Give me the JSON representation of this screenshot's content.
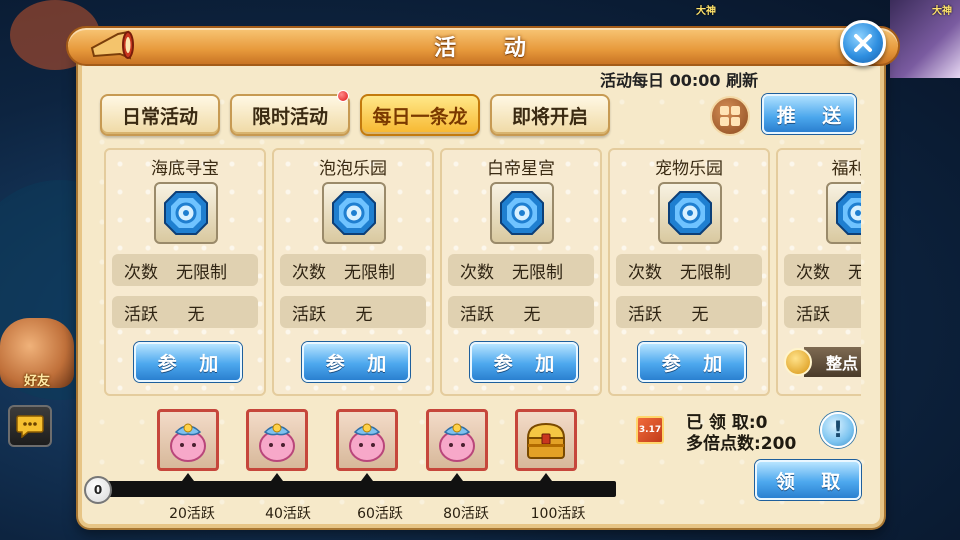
{
  "title": "活 动",
  "refresh_text": "活动每日 00:00 刷新",
  "tabs": [
    {
      "label": "日常活动",
      "active": false
    },
    {
      "label": "限时活动",
      "active": false,
      "has_notification": true
    },
    {
      "label": "每日一条龙",
      "active": true
    },
    {
      "label": "即将开启",
      "active": false
    }
  ],
  "push_button": "推 送",
  "activities": [
    {
      "name": "海底寻宝",
      "count_label": "次数",
      "count_value": "无限制",
      "active_label": "活跃",
      "active_value": "无",
      "button": "参 加"
    },
    {
      "name": "泡泡乐园",
      "count_label": "次数",
      "count_value": "无限制",
      "active_label": "活跃",
      "active_value": "无",
      "button": "参 加"
    },
    {
      "name": "白帝星宫",
      "count_label": "次数",
      "count_value": "无限制",
      "active_label": "活跃",
      "active_value": "无",
      "button": "参 加"
    },
    {
      "name": "宠物乐园",
      "count_label": "次数",
      "count_value": "无限制",
      "active_label": "活跃",
      "active_value": "无",
      "button": "参 加"
    },
    {
      "name": "福利时",
      "count_label": "次数",
      "count_value": "无",
      "active_label": "活跃",
      "active_value": "",
      "badge": "整点"
    }
  ],
  "progress": {
    "current": "0",
    "fraction": 0,
    "milestones": [
      "20活跃",
      "40活跃",
      "60活跃",
      "80活跃",
      "100活跃"
    ]
  },
  "stats": {
    "claimed": "已 领 取:0",
    "multiplier": "多倍点数:200"
  },
  "book_icon_text": "3.17",
  "claim_button": "领 取",
  "background": {
    "left_label": "好友",
    "top_label": "大神",
    "right_label": "大神"
  },
  "colors": {
    "accent_orange": "#e79a3c",
    "button_blue": "#4da8ee",
    "panel_bg": "#f6e9c9"
  }
}
